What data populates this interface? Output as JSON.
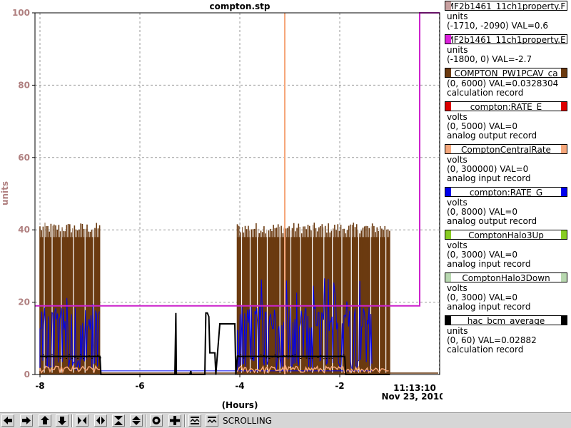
{
  "chart_data": {
    "type": "line",
    "title": "compton.stp",
    "ylabel": "units",
    "xlabel": "(Hours)",
    "ylim": [
      0,
      100
    ],
    "xlim": [
      -8.1,
      0
    ],
    "yticks": [
      "0",
      "20",
      "40",
      "60",
      "80",
      "100"
    ],
    "xticks": [
      "-8",
      "-6",
      "-4",
      "-2"
    ],
    "end_time": "11:13:10",
    "end_date": "Nov 23, 2010",
    "grid": true,
    "colors": {
      "brown": "#6b3a10",
      "blue": "#0000ee",
      "black": "#000000",
      "magenta": "#cc22cc",
      "orange": "#f5a77b",
      "ylabel_color": "#b08080"
    },
    "series": [
      {
        "name": "MF2b1461_11ch1property.E",
        "color": "#cc22cc",
        "x": [
          -8.1,
          -0.4,
          -0.4,
          0.0
        ],
        "y": [
          19,
          19,
          100,
          100
        ]
      },
      {
        "name": "ComptonCentralRate",
        "color": "#f5a77b",
        "x": [
          -3.1,
          -3.1
        ],
        "y": [
          0,
          100
        ]
      },
      {
        "name": "COMPTON_PW1PCAV_ca",
        "color": "#6b3a10",
        "segments": [
          [
            -8.0,
            -6.8
          ],
          [
            -4.05,
            -1.0
          ]
        ],
        "peak_level": 40,
        "level_range": [
          39,
          42
        ],
        "baseline": 0.5
      },
      {
        "name": "compton:RATE_G",
        "color": "#0000ee",
        "segments": [
          [
            -8.0,
            -6.8
          ],
          [
            -4.05,
            -1.35
          ]
        ],
        "typical_peak": 17,
        "max_peak": 27
      },
      {
        "name": "hac_bcm_average",
        "color": "#000000",
        "x": [
          -8.0,
          -6.8,
          -6.78,
          -5.3,
          -5.28,
          -5.27,
          -5.25,
          -5.0,
          -4.98,
          -4.97,
          -4.95,
          -4.7,
          -4.68,
          -4.65,
          -4.62,
          -4.6,
          -4.5,
          -4.48,
          -4.4,
          -4.38,
          -4.35,
          -4.3,
          -4.1,
          -4.08,
          -4.05,
          -1.9,
          -1.88,
          -1.0
        ],
        "y": [
          5,
          5,
          0,
          0,
          17,
          0,
          0,
          0,
          1,
          0,
          0,
          0,
          17,
          17,
          16,
          6,
          6,
          0,
          14,
          14,
          14,
          14,
          14,
          0,
          5,
          5,
          0,
          0
        ]
      }
    ]
  },
  "legend": [
    {
      "name": "MF2b1461_11ch1property.F",
      "color": "#c8a0a0",
      "bar": "left",
      "lines": [
        "units",
        "(-1710, -2090) VAL=0.6"
      ]
    },
    {
      "name": "MF2b1461_11ch1property.E",
      "color": "#dd22dd",
      "bar": "left",
      "lines": [
        "units",
        "(-1800, 0) VAL=-2.7"
      ]
    },
    {
      "name": "COMPTON_PW1PCAV_ca",
      "color": "#6b3a10",
      "bar": "both",
      "lines": [
        "(0, 6000) VAL=0.0328304",
        "calculation record"
      ]
    },
    {
      "name": "compton:RATE_E",
      "color": "#dd0000",
      "bar": "both",
      "lines": [
        "volts",
        "(0, 5000) VAL=0",
        "analog output record"
      ]
    },
    {
      "name": "ComptonCentralRate",
      "color": "#f5a77b",
      "bar": "both",
      "lines": [
        "volts",
        "(0, 300000) VAL=0",
        "analog input record"
      ]
    },
    {
      "name": "compton:RATE_G",
      "color": "#0000ee",
      "bar": "both",
      "lines": [
        "volts",
        "(0, 8000) VAL=0",
        "analog output record"
      ]
    },
    {
      "name": "ComptonHalo3Up",
      "color": "#88cc22",
      "bar": "both",
      "lines": [
        "volts",
        "(0, 3000) VAL=0",
        "analog input record"
      ]
    },
    {
      "name": "ComptonHalo3Down",
      "color": "#b8d8b0",
      "bar": "both",
      "lines": [
        "volts",
        "(0, 3000) VAL=0",
        "analog input record"
      ]
    },
    {
      "name": "hac_bcm_average",
      "color": "#000000",
      "bar": "both",
      "lines": [
        "units",
        "(0, 60) VAL=0.02882",
        "calculation record"
      ]
    }
  ],
  "toolbar": {
    "buttons": [
      "scroll-left",
      "scroll-right",
      "scroll-up",
      "scroll-down",
      "compress-x",
      "expand-x",
      "compress-y",
      "expand-y",
      "zoom-out",
      "zoom-in",
      "autoscale",
      "scrolling"
    ],
    "status": "SCROLLING"
  }
}
